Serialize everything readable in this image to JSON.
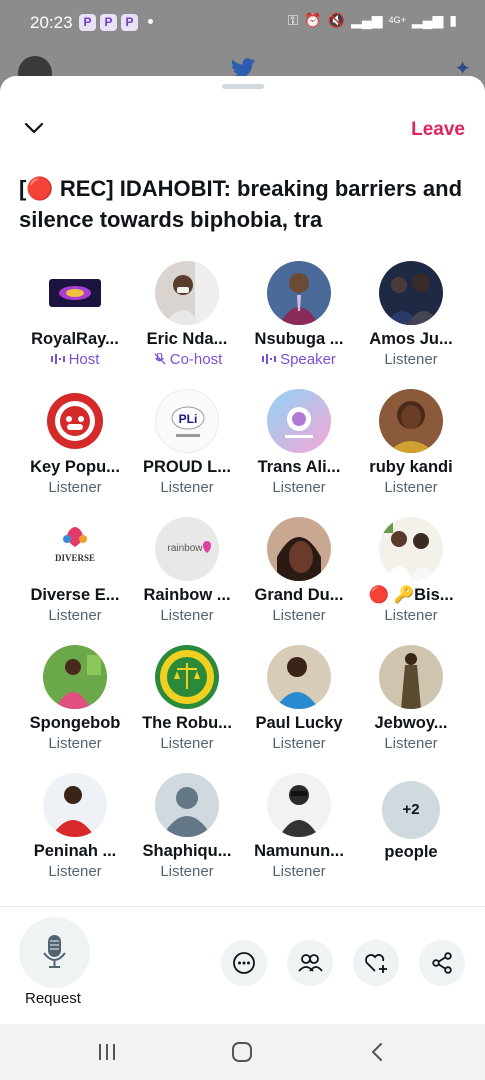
{
  "status_bar": {
    "time": "20:23",
    "app_icons": [
      "P",
      "P",
      "P"
    ],
    "network": "4G+"
  },
  "header": {
    "leave_label": "Leave",
    "title": "[🔴 REC] IDAHOBIT: breaking barriers and silence towards biphobia, tra"
  },
  "participants": [
    {
      "name": "RoyalRay...",
      "role": "Host"
    },
    {
      "name": "Eric Nda...",
      "role": "Co-host"
    },
    {
      "name": "Nsubuga ...",
      "role": "Speaker"
    },
    {
      "name": "Amos Ju...",
      "role": "Listener"
    },
    {
      "name": "Key Popu...",
      "role": "Listener"
    },
    {
      "name": "PROUD L...",
      "role": "Listener"
    },
    {
      "name": "Trans Ali...",
      "role": "Listener"
    },
    {
      "name": "ruby kandi",
      "role": "Listener"
    },
    {
      "name": "Diverse E...",
      "role": "Listener"
    },
    {
      "name": "Rainbow ...",
      "role": "Listener"
    },
    {
      "name": "Grand Du...",
      "role": "Listener"
    },
    {
      "name": "🔴 🔑Bis...",
      "role": "Listener"
    },
    {
      "name": "Spongebob",
      "role": "Listener"
    },
    {
      "name": "The Robu...",
      "role": "Listener"
    },
    {
      "name": "Paul Lucky",
      "role": "Listener"
    },
    {
      "name": "Jebwoy...",
      "role": "Listener"
    },
    {
      "name": "Peninah ...",
      "role": "Listener"
    },
    {
      "name": "Shaphiqu...",
      "role": "Listener"
    },
    {
      "name": "Namunun...",
      "role": "Listener"
    }
  ],
  "more_people": {
    "count": "+2",
    "label": "people"
  },
  "avatar_logo_text": {
    "rainbow": "rainbow",
    "diverse": "DIVERSE",
    "pli": "PLi"
  },
  "bottom_bar": {
    "request_label": "Request",
    "actions": [
      "more-icon",
      "people-icon",
      "heart-plus-icon",
      "share-icon"
    ]
  },
  "colors": {
    "accent_red": "#e0245e",
    "role_purple": "#7b4fd6",
    "secondary_text": "#536471"
  }
}
